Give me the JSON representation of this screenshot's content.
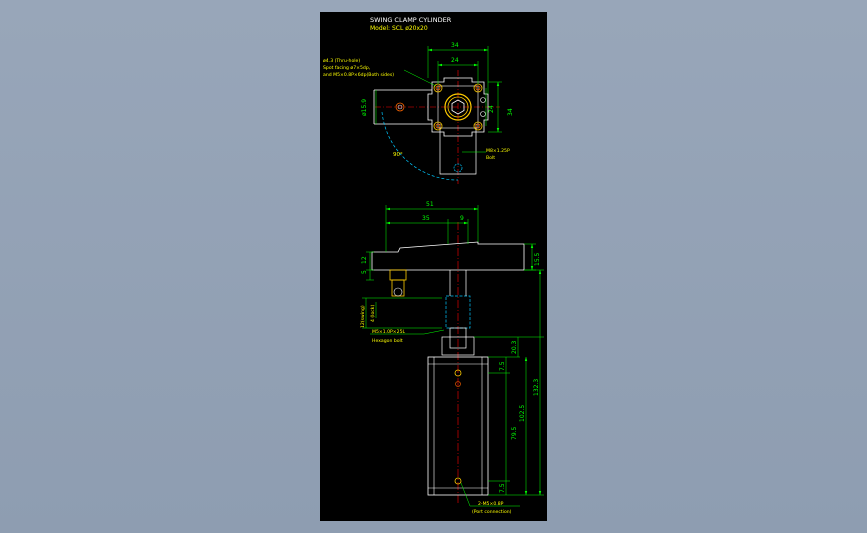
{
  "title": "SWING CLAMP CYLINDER",
  "model": "Model: SCL ø20x20",
  "top_view": {
    "dim_outer_width": "34",
    "dim_inner_width": "24",
    "dim_outer_height": "34",
    "dim_inner_height": "24",
    "dim_diameter": "ø15.9",
    "angle": "90°",
    "note_holes_1": "ø4.3 (Thru-hole)",
    "note_holes_2": "Spot facing ø7×5dp,",
    "note_holes_3": "and M5×0.8P×6dp(Both sides)",
    "note_bolt_1": "M8×1.25P",
    "note_bolt_2": "Bolt"
  },
  "side_view": {
    "dim_arm_length": "51",
    "dim_arm_left": "35",
    "dim_arm_right": "9",
    "dim_arm_height": "15.5",
    "dim_gap_5": "5",
    "dim_gap_12": "12",
    "dim_stroke_12": "12(swing)",
    "dim_stroke_4": "4 (lock)",
    "dim_20_3": "20.3",
    "dim_7_5_top": "7.5",
    "dim_79_5": "79.5",
    "dim_102_5": "102.5",
    "dim_7_5_bot": "7.5",
    "dim_132_3": "132.3",
    "note_hex_1": "M5×1.0P×25L",
    "note_hex_2": "Hexagon bolt",
    "note_port_1": "2-M5×0.8P",
    "note_port_2": "(Port connection)"
  },
  "colors": {
    "background": "#000000",
    "outline": "#ffffff",
    "dimension": "#00ff00",
    "centerline": "#ff0000",
    "hidden": "#00c8ff",
    "note": "#ffff00"
  }
}
